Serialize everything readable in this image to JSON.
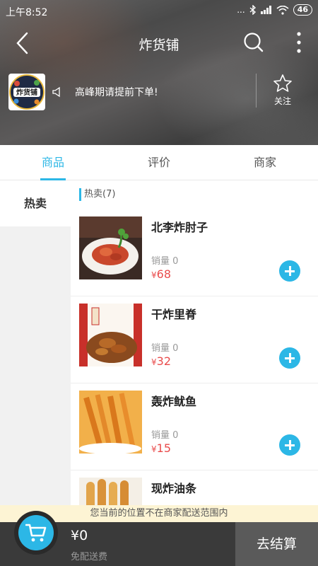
{
  "status": {
    "time": "上午8:52",
    "signal": "...",
    "battery": "46"
  },
  "nav": {
    "title": "炸货铺"
  },
  "store": {
    "logo_text": "炸货铺",
    "notice": "高峰期请提前下单!",
    "follow_label": "关注"
  },
  "tabs": [
    {
      "label": "商品",
      "active": true
    },
    {
      "label": "评价",
      "active": false
    },
    {
      "label": "商家",
      "active": false
    }
  ],
  "sidebar": {
    "items": [
      {
        "label": "热卖"
      }
    ]
  },
  "category": {
    "title": "热卖(7)"
  },
  "products": [
    {
      "name": "北李炸肘子",
      "sales": "销量 0",
      "currency": "¥",
      "price": "68"
    },
    {
      "name": "干炸里脊",
      "sales": "销量 0",
      "currency": "¥",
      "price": "32"
    },
    {
      "name": "轰炸鱿鱼",
      "sales": "销量 0",
      "currency": "¥",
      "price": "15"
    },
    {
      "name": "现炸油条",
      "sales": "",
      "currency": "",
      "price": ""
    }
  ],
  "banner": {
    "text": "您当前的位置不在商家配送范围内"
  },
  "cart": {
    "total": "¥0",
    "delivery": "免配送费",
    "checkout_label": "去结算"
  },
  "colors": {
    "accent": "#2cb7e6",
    "price": "#e94c4c",
    "bottom_bar": "#3a3a3a"
  }
}
